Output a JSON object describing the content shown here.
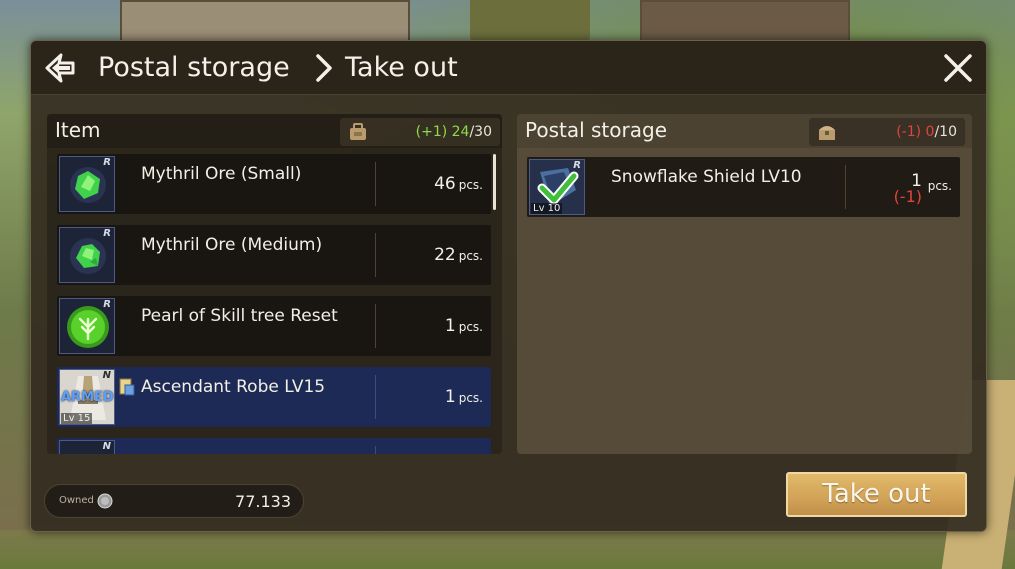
{
  "header": {
    "breadcrumb_1": "Postal storage",
    "breadcrumb_2": "Take out"
  },
  "inventory": {
    "title": "Item",
    "capacity": {
      "change": "(+1)",
      "current": "24",
      "max": "/30"
    },
    "items": [
      {
        "name": "Mythril Ore (Small)",
        "quantity": "46",
        "unit": "pcs.",
        "rarity": "R"
      },
      {
        "name": "Mythril Ore (Medium)",
        "quantity": "22",
        "unit": "pcs.",
        "rarity": "R"
      },
      {
        "name": "Pearl of Skill tree Reset",
        "quantity": "1",
        "unit": "pcs.",
        "rarity": "R"
      },
      {
        "name": "Ascendant Robe LV15",
        "quantity": "1",
        "unit": "pcs.",
        "rarity": "N",
        "level": "Lv 15",
        "status": "ARMED",
        "selected": true
      },
      {
        "name": "",
        "quantity": "",
        "unit": "",
        "rarity": "N"
      }
    ]
  },
  "postal": {
    "title": "Postal storage",
    "capacity": {
      "change": "(-1)",
      "current": "0",
      "max": "/10"
    },
    "items": [
      {
        "name": "Snowflake Shield LV10",
        "quantity": "1",
        "change": "(-1)",
        "unit": "pcs.",
        "rarity": "R",
        "level": "Lv 10",
        "checked": true
      }
    ]
  },
  "footer": {
    "owned_label": "Owned",
    "owned_value": "77.133",
    "take_out_label": "Take out"
  },
  "colors": {
    "selected_row": "#1c2a55",
    "button_gold": "#d1a257",
    "increase_green": "#8fd94a",
    "decrease_red": "#e0443a"
  },
  "icons": [
    "back-arrow-icon",
    "chevron-right-icon",
    "close-icon",
    "backpack-icon",
    "chest-icon",
    "coin-icon",
    "checkmark-icon",
    "document-icon"
  ]
}
